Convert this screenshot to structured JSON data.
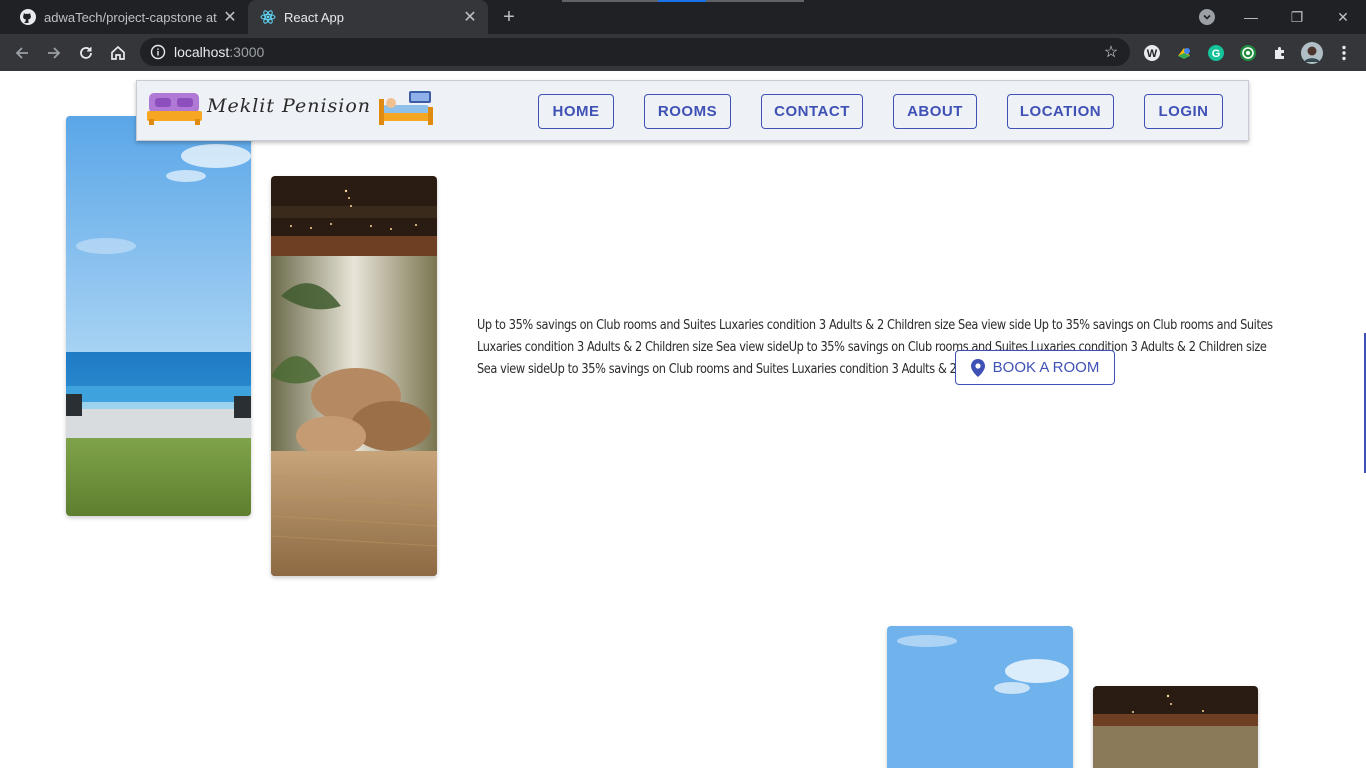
{
  "browser": {
    "tabs": [
      {
        "title": "adwaTech/project-capstone at n",
        "active": false
      },
      {
        "title": "React App",
        "active": true
      }
    ],
    "url_host": "localhost",
    "url_port": ":3000",
    "icons": [
      "github-icon",
      "react-icon",
      "back-icon",
      "forward-icon",
      "reload-icon",
      "home-icon",
      "info-icon",
      "star-icon",
      "extensions-icon",
      "menu-icon"
    ]
  },
  "header": {
    "logo_text": "Meklit Penision",
    "nav": [
      "HOME",
      "ROOMS",
      "CONTACT",
      "ABOUT",
      "LOCATION",
      "LOGIN"
    ]
  },
  "hero": {
    "promo_text": "Up to 35% savings on Club rooms and Suites Luxaries condition 3 Adults & 2 Children size Sea view side Up to 35% savings on Club rooms and Suites Luxaries condition 3 Adults & 2 Children size Sea view sideUp to 35% savings on Club rooms and Suites Luxaries condition 3 Adults & 2 Children size Sea view sideUp to 35% savings on Club rooms and Suites Luxaries condition 3 Adults & 2 Children size Sea view side",
    "book_button": "BOOK A ROOM"
  },
  "colors": {
    "accent": "#3f51b5",
    "header_bg": "#eef1f6",
    "chrome_dark": "#202124",
    "chrome_toolbar": "#35363a"
  }
}
